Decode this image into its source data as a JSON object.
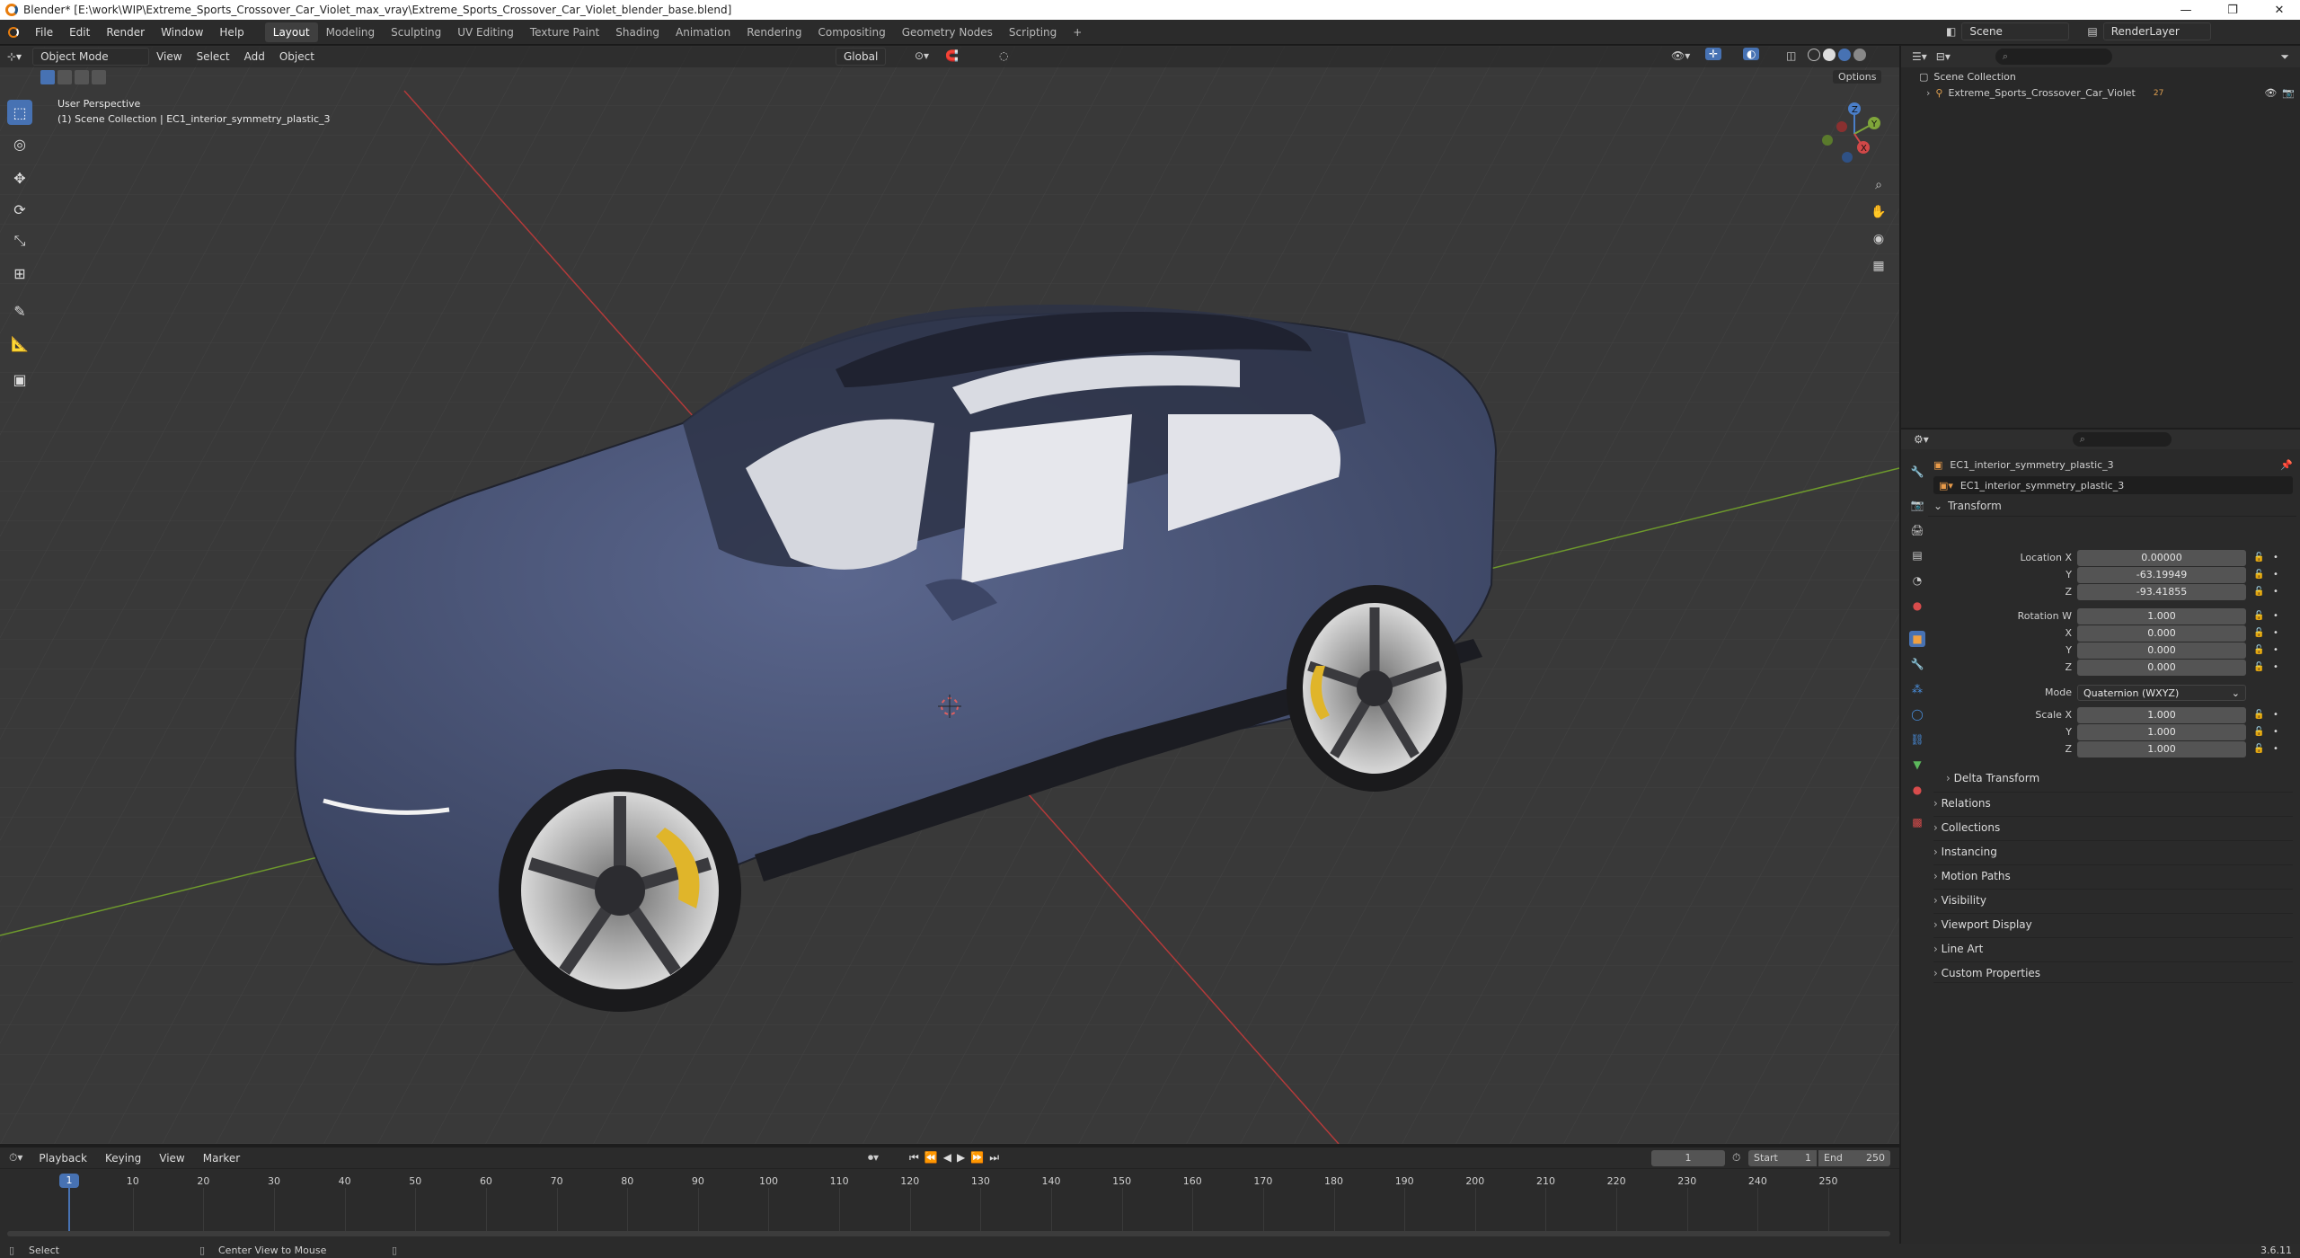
{
  "window": {
    "title": "Blender* [E:\\work\\WIP\\Extreme_Sports_Crossover_Car_Violet_max_vray\\Extreme_Sports_Crossover_Car_Violet_blender_base.blend]",
    "minimize": "—",
    "maximize": "❐",
    "close": "✕"
  },
  "menu": [
    "File",
    "Edit",
    "Render",
    "Window",
    "Help"
  ],
  "workspaces": [
    "Layout",
    "Modeling",
    "Sculpting",
    "UV Editing",
    "Texture Paint",
    "Shading",
    "Animation",
    "Rendering",
    "Compositing",
    "Geometry Nodes",
    "Scripting"
  ],
  "active_workspace": "Layout",
  "add_workspace": "+",
  "scene": {
    "icon": "scene-icon",
    "name": "Scene"
  },
  "view_layer": {
    "icon": "render-layer-icon",
    "name": "RenderLayer"
  },
  "viewport": {
    "mode": "Object Mode",
    "menus": [
      "View",
      "Select",
      "Add",
      "Object"
    ],
    "transform_orientation": "Global",
    "options": "Options",
    "perspective_label": "User Perspective",
    "collection_label": "(1) Scene Collection | EC1_interior_symmetry_plastic_3",
    "gizmo": {
      "x": "X",
      "y": "Y",
      "z": "Z"
    },
    "background_color": "#393939"
  },
  "outliner": {
    "search_placeholder": "",
    "root": "Scene Collection",
    "items": [
      {
        "name": "Extreme_Sports_Crossover_Car_Violet",
        "count": "27"
      }
    ]
  },
  "properties": {
    "object_name": "EC1_interior_symmetry_plastic_3",
    "data_name": "EC1_interior_symmetry_plastic_3",
    "transform_header": "Transform",
    "location": {
      "label": "Location X",
      "x": "0.00000",
      "y": "-63.19949",
      "z": "-93.41855"
    },
    "rotation": {
      "label": "Rotation W",
      "w": "1.000",
      "x": "0.000",
      "y": "0.000",
      "z": "0.000"
    },
    "mode": {
      "label": "Mode",
      "value": "Quaternion (WXYZ)"
    },
    "scale": {
      "label": "Scale X",
      "x": "1.000",
      "y": "1.000",
      "z": "1.000"
    },
    "axis_labels": {
      "x": "X",
      "y": "Y",
      "z": "Z"
    },
    "delta_transform": "Delta Transform",
    "panels": [
      "Relations",
      "Collections",
      "Instancing",
      "Motion Paths",
      "Visibility",
      "Viewport Display",
      "Line Art",
      "Custom Properties"
    ]
  },
  "timeline": {
    "menus": [
      "Playback",
      "Keying",
      "View",
      "Marker"
    ],
    "current_frame": "1",
    "start_label": "Start",
    "start": "1",
    "end_label": "End",
    "end": "250",
    "ticks": [
      "1",
      "10",
      "20",
      "30",
      "40",
      "50",
      "60",
      "70",
      "80",
      "90",
      "100",
      "110",
      "120",
      "130",
      "140",
      "150",
      "160",
      "170",
      "180",
      "190",
      "200",
      "210",
      "220",
      "230",
      "240",
      "250"
    ]
  },
  "status": {
    "select": "Select",
    "center": "Center View to Mouse",
    "version": "3.6.11"
  },
  "colors": {
    "accent": "#4772b3",
    "car_body": "#4a5578",
    "caliper": "#e0b52a",
    "x_axis": "#c83c3c",
    "y_axis": "#6e9a2c"
  }
}
